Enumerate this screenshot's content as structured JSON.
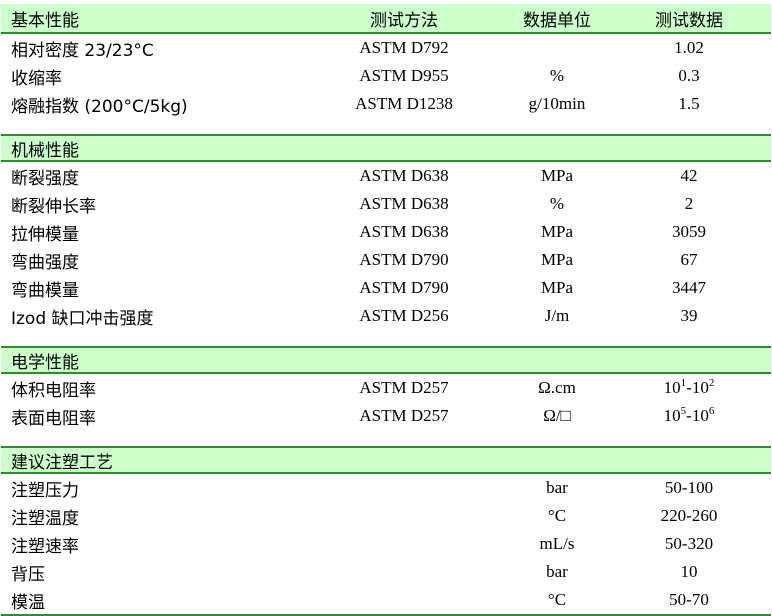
{
  "header": {
    "property": "基本性能",
    "method": "测试方法",
    "unit": "数据单位",
    "value": "测试数据"
  },
  "basic": [
    {
      "name": "相对密度 23/23°C",
      "method": "ASTM D792",
      "unit": "",
      "value": "1.02"
    },
    {
      "name": "收缩率",
      "method": "ASTM D955",
      "unit": "%",
      "value": "0.3"
    },
    {
      "name": "熔融指数 (200°C/5kg)",
      "method": "ASTM D1238",
      "unit": "g/10min",
      "value": "1.5"
    }
  ],
  "mechanical": {
    "title": "机械性能",
    "rows": [
      {
        "name": "断裂强度",
        "method": "ASTM D638",
        "unit": "MPa",
        "value": "42"
      },
      {
        "name": "断裂伸长率",
        "method": "ASTM D638",
        "unit": "%",
        "value": "2"
      },
      {
        "name": "拉伸模量",
        "method": "ASTM D638",
        "unit": "MPa",
        "value": "3059"
      },
      {
        "name": "弯曲强度",
        "method": "ASTM D790",
        "unit": "MPa",
        "value": "67"
      },
      {
        "name": "弯曲模量",
        "method": "ASTM D790",
        "unit": "MPa",
        "value": "3447"
      },
      {
        "name": "Izod 缺口冲击强度",
        "method": "ASTM D256",
        "unit": "J/m",
        "value": "39"
      }
    ]
  },
  "electrical": {
    "title": "电学性能",
    "rows": [
      {
        "name": "体积电阻率",
        "method": "ASTM D257",
        "unit": "Ω.cm",
        "base1": "10",
        "exp1": "1",
        "sep": "-",
        "base2": "10",
        "exp2": "2"
      },
      {
        "name": "表面电阻率",
        "method": "ASTM D257",
        "unit": "Ω/□",
        "base1": "10",
        "exp1": "5",
        "sep": "-",
        "base2": "10",
        "exp2": "6"
      }
    ]
  },
  "molding": {
    "title": "建议注塑工艺",
    "rows": [
      {
        "name": "注塑压力",
        "method": "",
        "unit": "bar",
        "value": "50-100"
      },
      {
        "name": "注塑温度",
        "method": "",
        "unit": "°C",
        "value": "220-260"
      },
      {
        "name": "注塑速率",
        "method": "",
        "unit": "mL/s",
        "value": "50-320"
      },
      {
        "name": "背压",
        "method": "",
        "unit": "bar",
        "value": "10"
      },
      {
        "name": "模温",
        "method": "",
        "unit": "°C",
        "value": "50-70"
      }
    ]
  }
}
